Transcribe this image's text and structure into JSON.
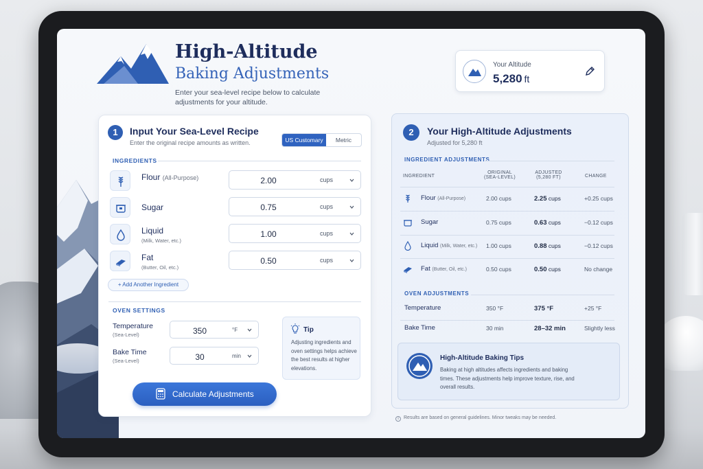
{
  "header": {
    "title_line1": "High-Altitude",
    "title_line2": "Baking Adjustments",
    "subtitle": "Enter your sea-level recipe below to calculate adjustments for your altitude."
  },
  "altitude": {
    "label": "Your Altitude",
    "value": "5,280",
    "unit": "ft",
    "edit_icon": "pencil-icon"
  },
  "input_card": {
    "step": "1",
    "title": "Input Your Sea-Level Recipe",
    "subtitle": "Enter the original recipe amounts as written.",
    "unit_toggle": {
      "active": "US Customary",
      "inactive": "Metric"
    },
    "ingredients_header": "INGREDIENTS",
    "ingredients": [
      {
        "name": "Flour",
        "paren": "(All-Purpose)",
        "hint": "",
        "value": "2.00",
        "unit": "cups",
        "icon": "wheat-icon"
      },
      {
        "name": "Sugar",
        "paren": "",
        "hint": "",
        "value": "0.75",
        "unit": "cups",
        "icon": "sugar-bowl-icon"
      },
      {
        "name": "Liquid",
        "paren": "",
        "hint": "(Milk, Water, etc.)",
        "value": "1.00",
        "unit": "cups",
        "icon": "droplet-icon"
      },
      {
        "name": "Fat",
        "paren": "",
        "hint": "(Butter, Oil, etc.)",
        "value": "0.50",
        "unit": "cups",
        "icon": "butter-icon"
      }
    ],
    "add_ingredient": "+ Add Another Ingredient",
    "oven_header": "OVEN SETTINGS",
    "oven": [
      {
        "label": "Temperature",
        "hint": "(Sea-Level)",
        "value": "350",
        "unit": "°F"
      },
      {
        "label": "Bake Time",
        "hint": "(Sea-Level)",
        "value": "30",
        "unit": "min"
      }
    ],
    "tip": {
      "title": "Tip",
      "text": "Adjusting ingredients and oven settings helps achieve the best results at higher elevations.",
      "icon": "lightbulb-icon"
    },
    "calculate_button": "Calculate Adjustments"
  },
  "results_card": {
    "step": "2",
    "title": "Your High-Altitude Adjustments",
    "subtitle": "Adjusted for 5,280 ft",
    "ingredients_header": "INGREDIENT ADJUSTMENTS",
    "columns": {
      "ingredient": "INGREDIENT",
      "original": "ORIGINAL",
      "original_sub": "(SEA-LEVEL)",
      "adjusted": "ADJUSTED",
      "adjusted_sub": "(5,280 FT)",
      "change": "CHANGE"
    },
    "rows": [
      {
        "name": "Flour",
        "paren": "(All-Purpose)",
        "original": "2.00 cups",
        "adjusted_num": "2.25",
        "adjusted_unit": "cups",
        "change": "+0.25 cups",
        "icon": "wheat-icon"
      },
      {
        "name": "Sugar",
        "paren": "",
        "original": "0.75 cups",
        "adjusted_num": "0.63",
        "adjusted_unit": "cups",
        "change": "−0.12 cups",
        "icon": "sugar-bowl-icon"
      },
      {
        "name": "Liquid",
        "paren": "(Milk, Water, etc.)",
        "original": "1.00 cups",
        "adjusted_num": "0.88",
        "adjusted_unit": "cups",
        "change": "−0.12 cups",
        "icon": "droplet-icon"
      },
      {
        "name": "Fat",
        "paren": "(Butter, Oil, etc.)",
        "original": "0.50 cups",
        "adjusted_num": "0.50",
        "adjusted_unit": "cups",
        "change": "No change",
        "icon": "butter-icon"
      }
    ],
    "oven_header": "OVEN ADJUSTMENTS",
    "oven_rows": [
      {
        "name": "Temperature",
        "original": "350 °F",
        "adjusted": "375 °F",
        "change": "+25 °F"
      },
      {
        "name": "Bake Time",
        "original": "30 min",
        "adjusted": "28–32 min",
        "change": "Slightly less"
      }
    ],
    "tips": {
      "title": "High-Altitude Baking Tips",
      "text": "Baking at high altitudes affects ingredients and baking times. These adjustments help improve texture, rise, and overall results.",
      "icon": "mountain-icon"
    }
  },
  "footnote": "Results are based on general guidelines. Minor tweaks may be needed.",
  "colors": {
    "accent": "#2f5fb3",
    "button": "#3b76d9",
    "heading": "#1e2d5c"
  }
}
